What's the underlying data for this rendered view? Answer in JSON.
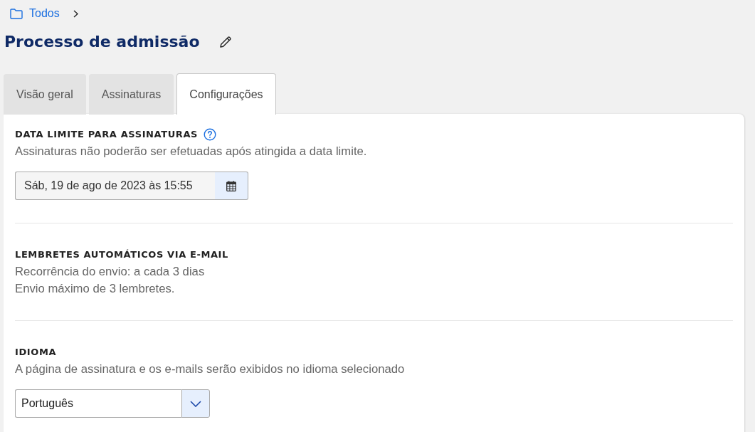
{
  "breadcrumb": {
    "label": "Todos"
  },
  "title": "Processo de admissão",
  "tabs": [
    {
      "label": "Visão geral",
      "selected": false
    },
    {
      "label": "Assinaturas",
      "selected": false
    },
    {
      "label": "Configurações",
      "selected": true
    }
  ],
  "sections": [
    {
      "kind": "date",
      "title": "DATA LIMITE PARA ASSINATURAS",
      "help": true,
      "lines": [
        "Assinaturas não poderão ser efetuadas após atingida a data limite."
      ],
      "value": "Sáb, 19 de ago de 2023 às 15:55"
    },
    {
      "kind": "info",
      "title": "LEMBRETES AUTOMÁTICOS VIA E-MAIL",
      "help": false,
      "lines": [
        "Recorrência do envio: a cada 3 dias",
        "Envio máximo de 3 lembretes."
      ]
    },
    {
      "kind": "select",
      "title": "IDIOMA",
      "help": false,
      "lines": [
        "A página de assinatura e os e-mails serão exibidos no idioma selecionado"
      ],
      "value": "Português"
    }
  ]
}
